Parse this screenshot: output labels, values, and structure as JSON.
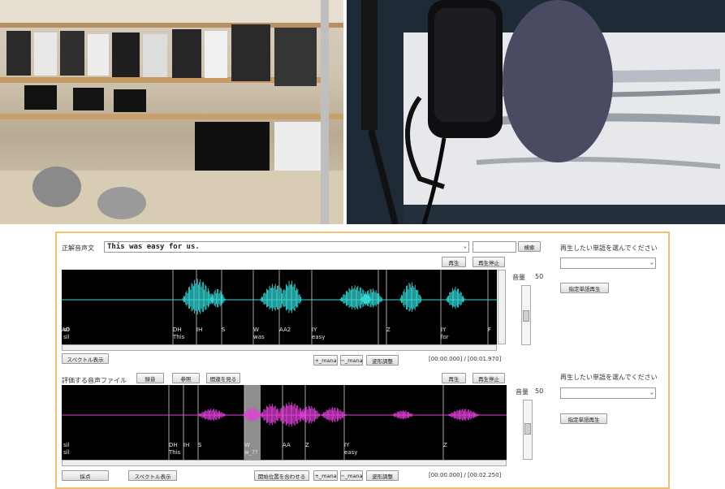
{
  "panel1": {
    "label": "正解音声文",
    "sentence": "This was easy for us.",
    "search_btn": "検索",
    "play_btn": "再生",
    "stop_btn": "再生停止",
    "volume_label": "音量",
    "volume_value": "50",
    "phonemes": [
      "sil",
      "DH",
      "IH",
      "S",
      "W",
      "AA2",
      "IY",
      "Z",
      "IY",
      "F",
      "AO"
    ],
    "words": [
      "sil",
      "This",
      "was",
      "easy",
      "for"
    ],
    "spectrum_btn": "スペクトル表示",
    "zoom_in_btn": "+_mana",
    "zoom_out_btn": "−_mana",
    "wave_adjust_btn": "波形調整",
    "time": "[00:00.000] / [00:01.970]",
    "wave_color": "#35d7d7"
  },
  "panel2": {
    "label": "評価する音声ファイル",
    "record_btn": "録音",
    "ref_btn": "参照",
    "correct_btn": "間違を見る",
    "play_btn": "再生",
    "stop_btn": "再生停止",
    "volume_label": "音量",
    "volume_value": "50",
    "phonemes": [
      "sil",
      "DH",
      "IH",
      "S",
      "W",
      "AA",
      "Z",
      "IY",
      "Z"
    ],
    "words": [
      "sil",
      "This",
      "w_??",
      "easy"
    ],
    "eval_btn": "採点",
    "spectrum_btn": "スペクトル表示",
    "align_btn": "開始位置を合わせる",
    "zoom_in_btn": "+_mana",
    "zoom_out_btn": "−_mana",
    "wave_adjust_btn": "波形調整",
    "time": "[00:00.000] / [00:02.250]",
    "wave_color": "#e040d8"
  },
  "side1": {
    "prompt": "再生したい単語を選んでください",
    "play_word_btn": "指定単語再生"
  },
  "side2": {
    "prompt": "再生したい単語を選んでください",
    "play_word_btn": "指定単語再生"
  }
}
